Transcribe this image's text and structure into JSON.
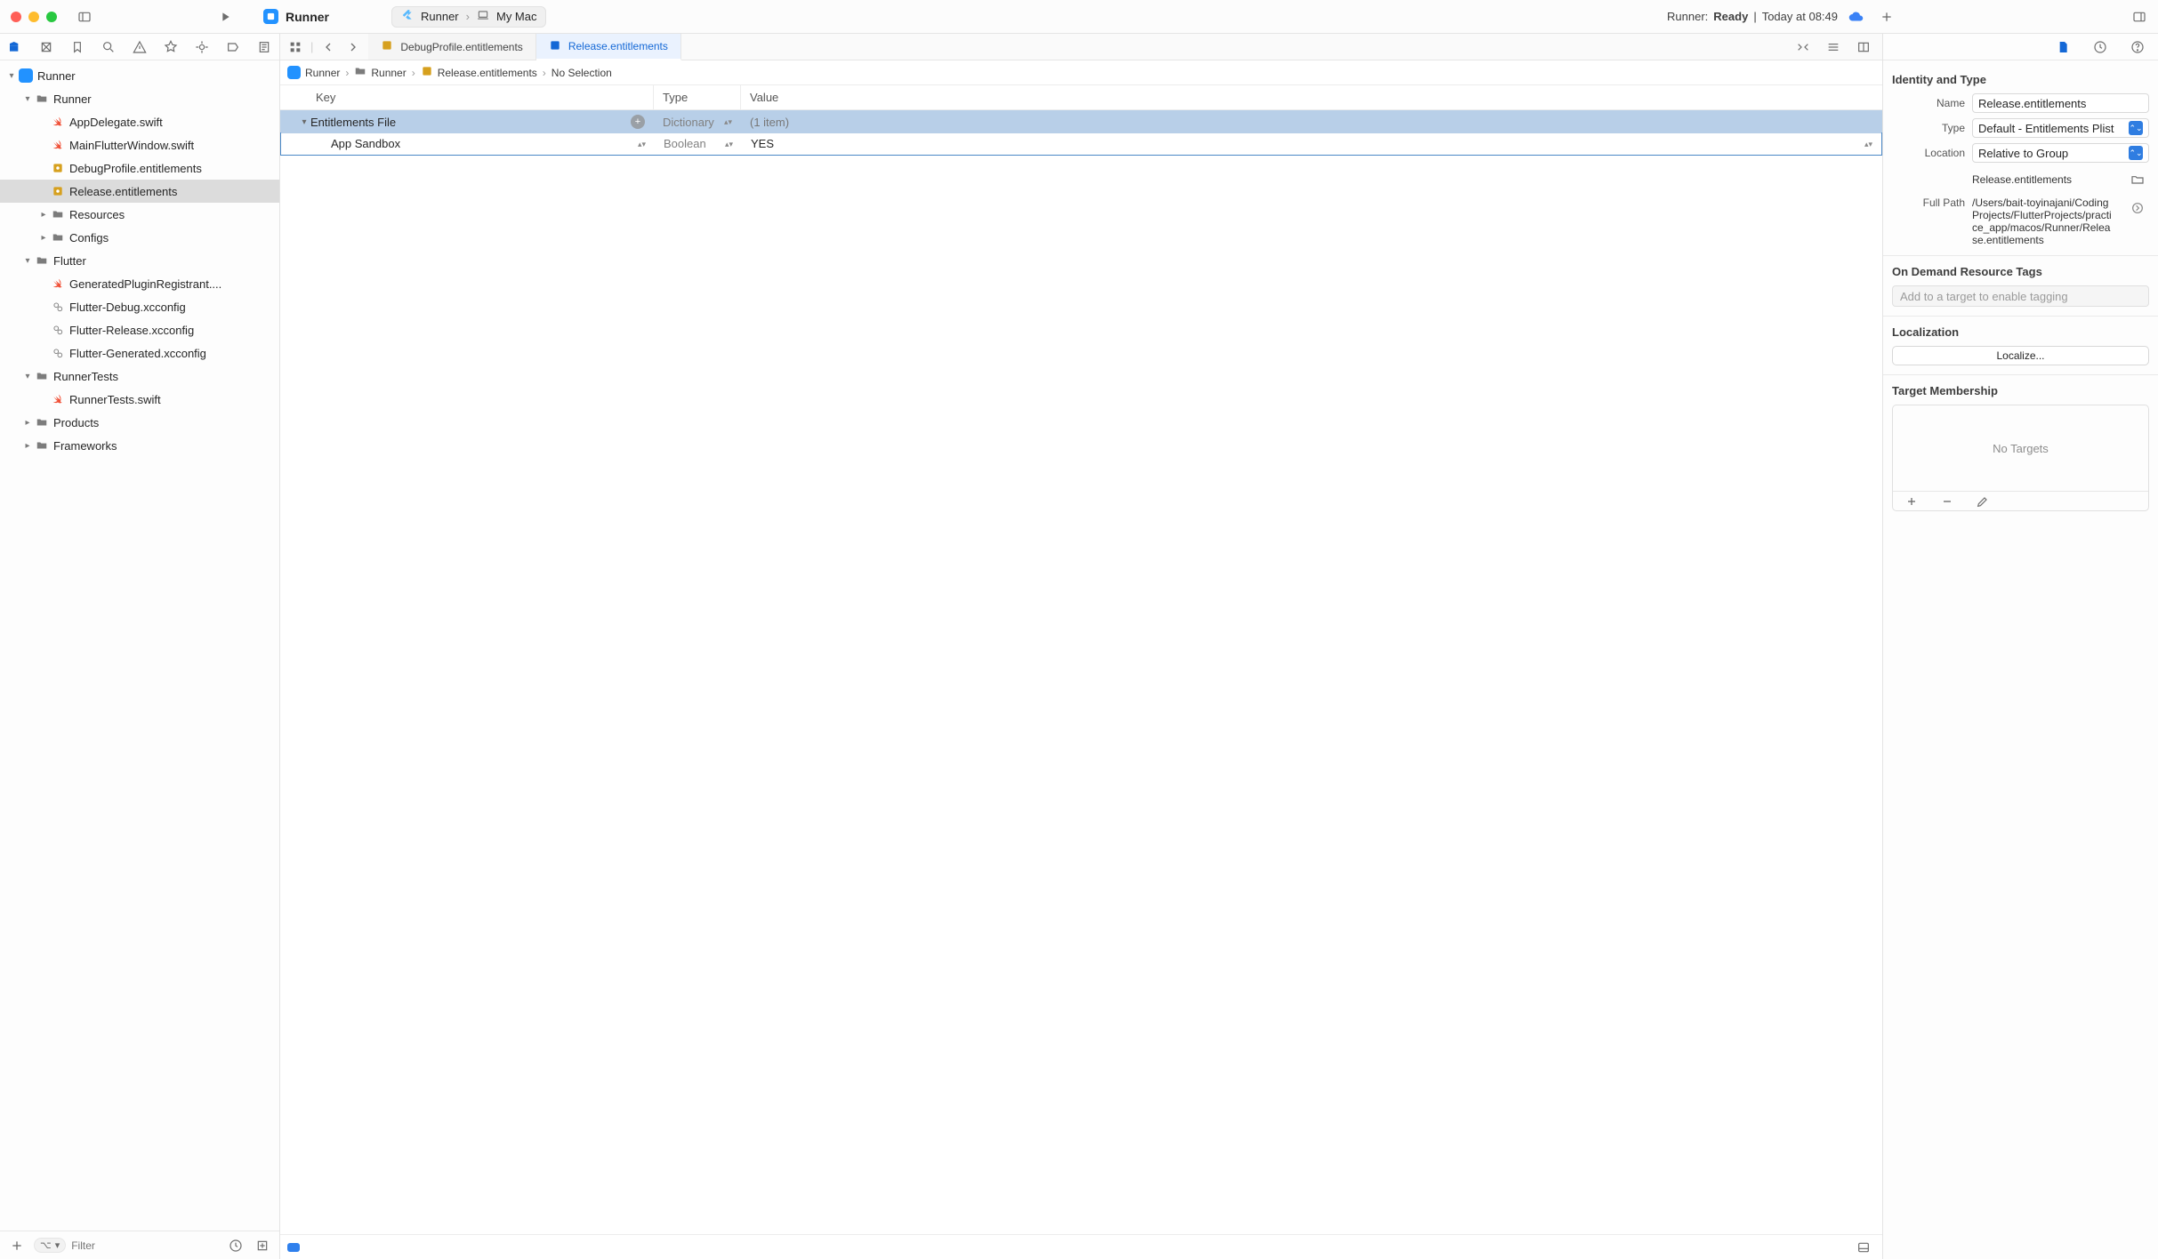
{
  "titlebar": {
    "project_title": "Runner",
    "scheme": {
      "scheme_name": "Runner",
      "destination": "My Mac"
    },
    "status_prefix": "Runner:",
    "status_state": "Ready",
    "status_separator": "|",
    "status_time": "Today at 08:49"
  },
  "tabs": {
    "items": [
      {
        "label": "DebugProfile.entitlements",
        "active": false
      },
      {
        "label": "Release.entitlements",
        "active": true
      }
    ]
  },
  "jumpbar": {
    "segments": [
      "Runner",
      "Runner",
      "Release.entitlements",
      "No Selection"
    ]
  },
  "plist": {
    "columns": {
      "key": "Key",
      "type": "Type",
      "value": "Value"
    },
    "rows": [
      {
        "key": "Entitlements File",
        "type": "Dictionary",
        "value": "(1 item)",
        "level": 0,
        "expanded": true,
        "selected": true,
        "value_dim": true,
        "has_add": true
      },
      {
        "key": "App Sandbox",
        "type": "Boolean",
        "value": "YES",
        "level": 1,
        "expanded": false,
        "selected": false,
        "value_dim": false,
        "child_editing": true
      }
    ]
  },
  "navigator": {
    "filter_placeholder": "Filter",
    "tree": [
      {
        "label": "Runner",
        "icon": "app",
        "level": 0,
        "disclosure": "open"
      },
      {
        "label": "Runner",
        "icon": "folder",
        "level": 1,
        "disclosure": "open"
      },
      {
        "label": "AppDelegate.swift",
        "icon": "swift",
        "level": 2
      },
      {
        "label": "MainFlutterWindow.swift",
        "icon": "swift",
        "level": 2
      },
      {
        "label": "DebugProfile.entitlements",
        "icon": "ent",
        "level": 2
      },
      {
        "label": "Release.entitlements",
        "icon": "ent",
        "level": 2,
        "selected": true
      },
      {
        "label": "Resources",
        "icon": "folder",
        "level": 2,
        "disclosure": "closed"
      },
      {
        "label": "Configs",
        "icon": "folder",
        "level": 2,
        "disclosure": "closed"
      },
      {
        "label": "Flutter",
        "icon": "folder",
        "level": 1,
        "disclosure": "open"
      },
      {
        "label": "GeneratedPluginRegistrant....",
        "icon": "swift",
        "level": 2
      },
      {
        "label": "Flutter-Debug.xcconfig",
        "icon": "gear",
        "level": 2
      },
      {
        "label": "Flutter-Release.xcconfig",
        "icon": "gear",
        "level": 2
      },
      {
        "label": "Flutter-Generated.xcconfig",
        "icon": "gear",
        "level": 2
      },
      {
        "label": "RunnerTests",
        "icon": "folder",
        "level": 1,
        "disclosure": "open"
      },
      {
        "label": "RunnerTests.swift",
        "icon": "swift",
        "level": 2
      },
      {
        "label": "Products",
        "icon": "folder",
        "level": 1,
        "disclosure": "closed"
      },
      {
        "label": "Frameworks",
        "icon": "folder",
        "level": 1,
        "disclosure": "closed"
      }
    ]
  },
  "inspector": {
    "identity_title": "Identity and Type",
    "name_label": "Name",
    "name_value": "Release.entitlements",
    "type_label": "Type",
    "type_value": "Default - Entitlements Plist",
    "location_label": "Location",
    "location_value": "Relative to Group",
    "location_file": "Release.entitlements",
    "fullpath_label": "Full Path",
    "fullpath_value": "/Users/bait-toyinajani/CodingProjects/FlutterProjects/practice_app/macos/Runner/Release.entitlements",
    "odr_title": "On Demand Resource Tags",
    "odr_placeholder": "Add to a target to enable tagging",
    "localization_title": "Localization",
    "localize_button": "Localize...",
    "membership_title": "Target Membership",
    "membership_empty": "No Targets"
  }
}
